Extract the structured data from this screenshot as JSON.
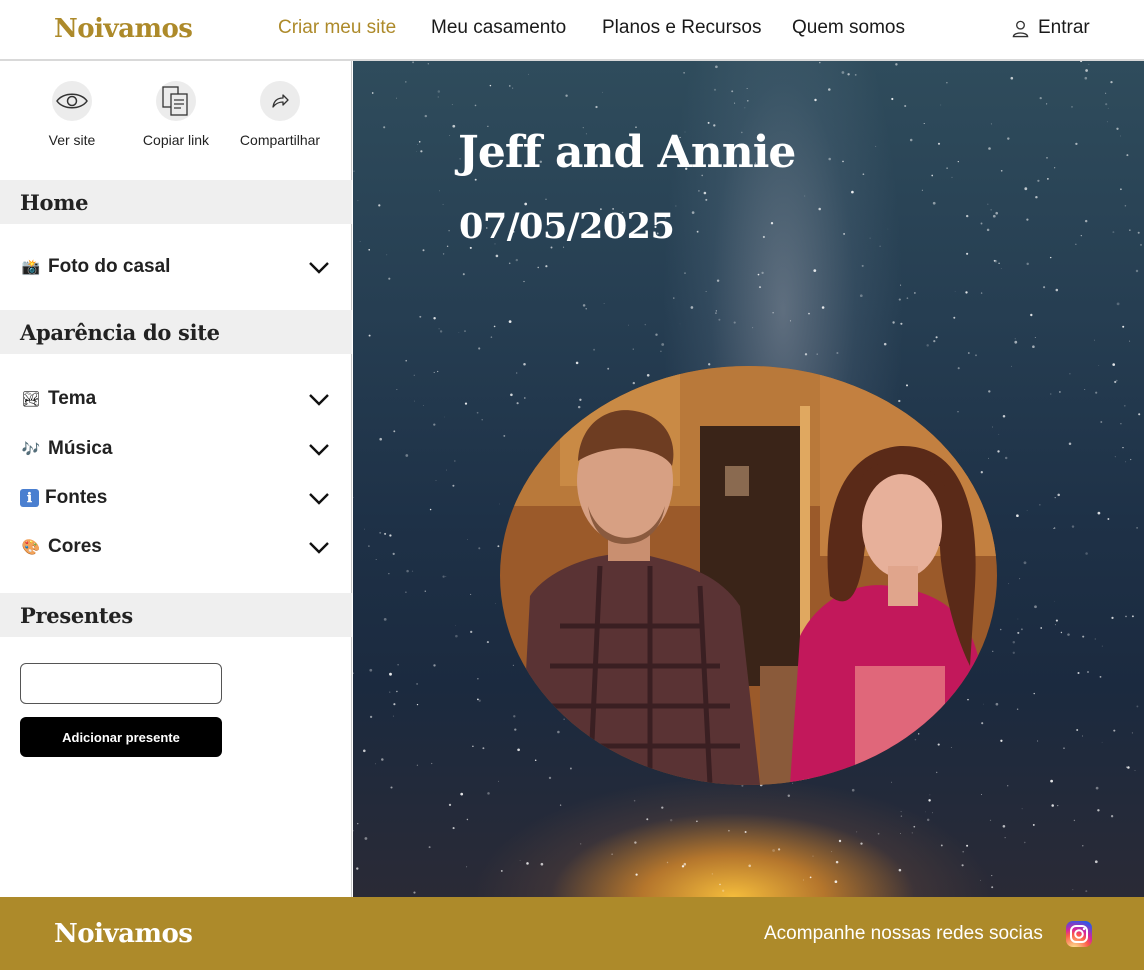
{
  "header": {
    "brand": "Noivamos",
    "nav": [
      "Criar meu site",
      "Meu casamento",
      "Planos e Recursos",
      "Quem somos"
    ],
    "login_label": "Entrar"
  },
  "sidebar": {
    "actions": [
      {
        "label": "Ver site",
        "icon": "eye-icon"
      },
      {
        "label": "Copiar link",
        "icon": "copy-icon"
      },
      {
        "label": "Compartilhar",
        "icon": "share-icon"
      }
    ],
    "sections": {
      "home": {
        "title": "Home",
        "items": [
          {
            "emoji": "📸",
            "label": "Foto do casal"
          }
        ]
      },
      "appearance": {
        "title": "Aparência do site",
        "items": [
          {
            "emoji": "🏞",
            "label": "Tema"
          },
          {
            "emoji": "🎶",
            "label": "Música"
          },
          {
            "emoji": "ℹ",
            "label": "Fontes"
          },
          {
            "emoji": "🎨",
            "label": "Cores"
          }
        ]
      },
      "gifts": {
        "title": "Presentes",
        "input_value": "",
        "button_label": "Adicionar presente"
      }
    }
  },
  "preview": {
    "couple_names": "Jeff and Annie",
    "wedding_date": "07/05/2025"
  },
  "footer": {
    "brand": "Noivamos",
    "social_text": "Acompanhe nossas redes socias",
    "social_icon": "instagram-icon"
  },
  "colors": {
    "brand_gold": "#ad8a2a",
    "button_black": "#000000",
    "section_gray": "#efefef"
  }
}
